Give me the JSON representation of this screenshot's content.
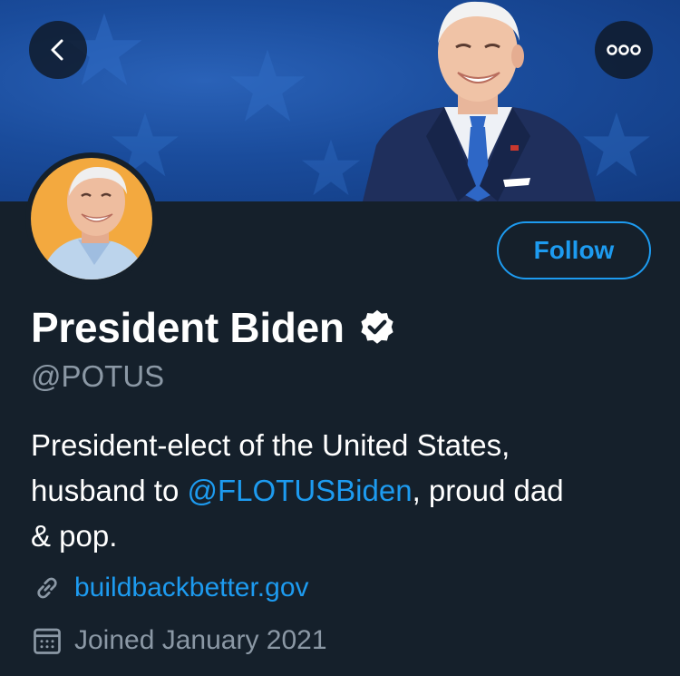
{
  "header": {
    "back_icon": "chevron-left-icon",
    "more_icon": "more-horizontal-icon"
  },
  "profile": {
    "name": "President Biden",
    "verified": true,
    "handle": "@POTUS",
    "follow_label": "Follow",
    "bio": {
      "part1": "President-elect of the United States,",
      "part2": "husband to ",
      "mention": "@FLOTUSBiden",
      "part3": ", proud dad",
      "part4": "& pop."
    },
    "website": "buildbackbetter.gov",
    "joined": "Joined January 2021"
  },
  "colors": {
    "background": "#15202b",
    "accent": "#1d9bf0",
    "secondary_text": "#8b98a5",
    "banner": "#1a4c9c"
  }
}
